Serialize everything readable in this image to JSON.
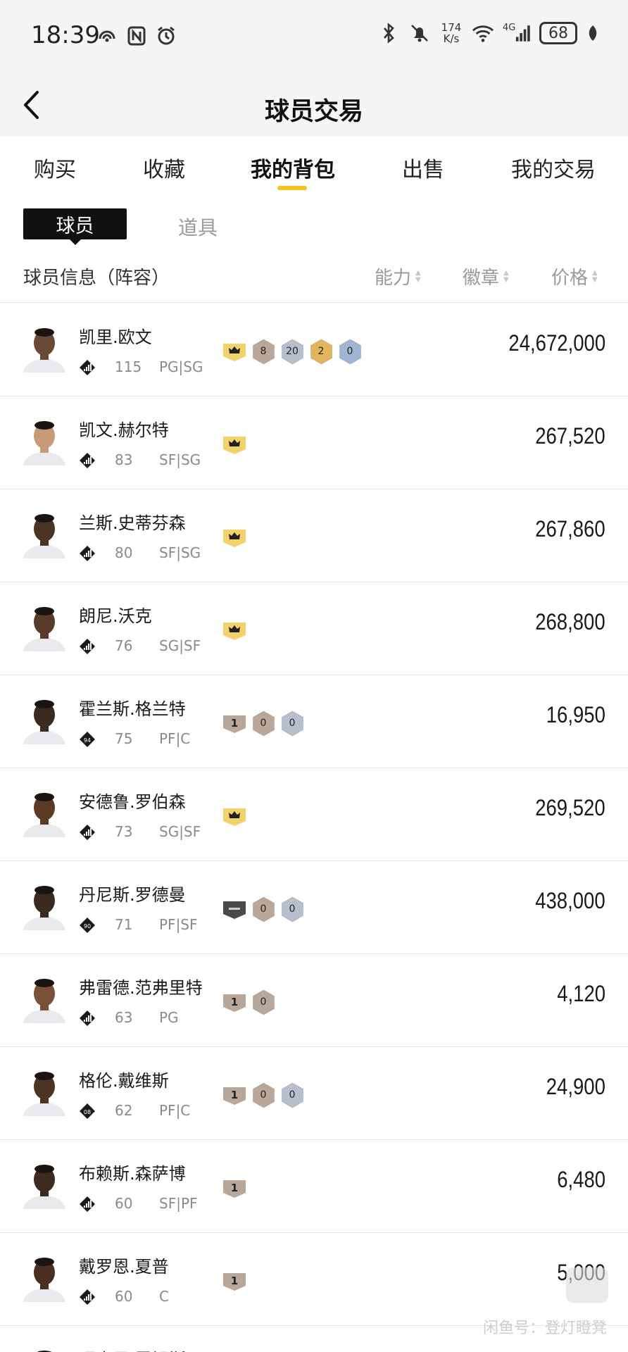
{
  "status_bar": {
    "time": "18:39",
    "net_speed": "174 K/s",
    "network": "4G",
    "battery": "68",
    "icons": [
      "hotspot-icon",
      "nfc-icon",
      "alarm-icon",
      "bluetooth-icon",
      "mute-icon",
      "wifi-icon",
      "signal-icon",
      "leaf-icon"
    ]
  },
  "header": {
    "title": "球员交易",
    "back_icon": "chevron-left-icon"
  },
  "tabs": [
    {
      "label": "购买",
      "active": false
    },
    {
      "label": "收藏",
      "active": false
    },
    {
      "label": "我的背包",
      "active": true
    },
    {
      "label": "出售",
      "active": false
    },
    {
      "label": "我的交易",
      "active": false
    }
  ],
  "subtabs": {
    "active": "球员",
    "other": "道具"
  },
  "columns": {
    "info": "球员信息（阵容）",
    "ability": "能力",
    "badge": "徽章",
    "price": "价格"
  },
  "colors": {
    "accent": "#f6c21c",
    "crown_badge": "#f2d36b",
    "bronze_hex": "#b9a79a",
    "silver_hex": "#b8bfcc",
    "gold_hex": "#e2b45c",
    "blue_hex": "#9fb5d2"
  },
  "players": [
    {
      "name": "凯里.欧文",
      "ovr": "115",
      "pos": "PG|SG",
      "diamond": "bars",
      "badges": [
        {
          "t": "crown"
        },
        {
          "t": "hex",
          "c": "bronze",
          "v": "8"
        },
        {
          "t": "hex",
          "c": "silver",
          "v": "20"
        },
        {
          "t": "hex",
          "c": "gold",
          "v": "2"
        },
        {
          "t": "hex",
          "c": "blue",
          "v": "0"
        }
      ],
      "price": "24,672,000"
    },
    {
      "name": "凯文.赫尔特",
      "ovr": "83",
      "pos": "SF|SG",
      "diamond": "bars",
      "badges": [
        {
          "t": "crown"
        }
      ],
      "price": "267,520"
    },
    {
      "name": "兰斯.史蒂芬森",
      "ovr": "80",
      "pos": "SF|SG",
      "diamond": "bars",
      "badges": [
        {
          "t": "crown"
        }
      ],
      "price": "267,860"
    },
    {
      "name": "朗尼.沃克",
      "ovr": "76",
      "pos": "SG|SF",
      "diamond": "bars",
      "badges": [
        {
          "t": "crown"
        }
      ],
      "price": "268,800"
    },
    {
      "name": "霍兰斯.格兰特",
      "ovr": "75",
      "pos": "PF|C",
      "diamond": "94",
      "badges": [
        {
          "t": "shield",
          "v": "1"
        },
        {
          "t": "hex",
          "c": "bronze",
          "v": "0"
        },
        {
          "t": "hex",
          "c": "silver",
          "v": "0"
        }
      ],
      "price": "16,950"
    },
    {
      "name": "安德鲁.罗伯森",
      "ovr": "73",
      "pos": "SG|SF",
      "diamond": "bars",
      "badges": [
        {
          "t": "crown"
        }
      ],
      "price": "269,520"
    },
    {
      "name": "丹尼斯.罗德曼",
      "ovr": "71",
      "pos": "PF|SF",
      "diamond": "90",
      "badges": [
        {
          "t": "shield-dark",
          "v": ""
        },
        {
          "t": "hex",
          "c": "bronze",
          "v": "0"
        },
        {
          "t": "hex",
          "c": "silver",
          "v": "0"
        }
      ],
      "price": "438,000"
    },
    {
      "name": "弗雷德.范弗里特",
      "ovr": "63",
      "pos": "PG",
      "diamond": "bars",
      "badges": [
        {
          "t": "shield",
          "v": "1"
        },
        {
          "t": "hex",
          "c": "bronze",
          "v": "0"
        }
      ],
      "price": "4,120"
    },
    {
      "name": "格伦.戴维斯",
      "ovr": "62",
      "pos": "PF|C",
      "diamond": "08",
      "badges": [
        {
          "t": "shield",
          "v": "1"
        },
        {
          "t": "hex",
          "c": "bronze",
          "v": "0"
        },
        {
          "t": "hex",
          "c": "silver",
          "v": "0"
        }
      ],
      "price": "24,900"
    },
    {
      "name": "布赖斯.森萨博",
      "ovr": "60",
      "pos": "SF|PF",
      "diamond": "bars",
      "badges": [
        {
          "t": "shield",
          "v": "1"
        }
      ],
      "price": "6,480"
    },
    {
      "name": "戴罗恩.夏普",
      "ovr": "60",
      "pos": "C",
      "diamond": "bars",
      "badges": [
        {
          "t": "shield",
          "v": "1"
        }
      ],
      "price": "5,000"
    },
    {
      "name": "理查思.霍姆斯",
      "ovr": "",
      "pos": "",
      "diamond": "",
      "badges": [],
      "price": ""
    }
  ],
  "watermark": "闲鱼号：登灯瞪凳"
}
